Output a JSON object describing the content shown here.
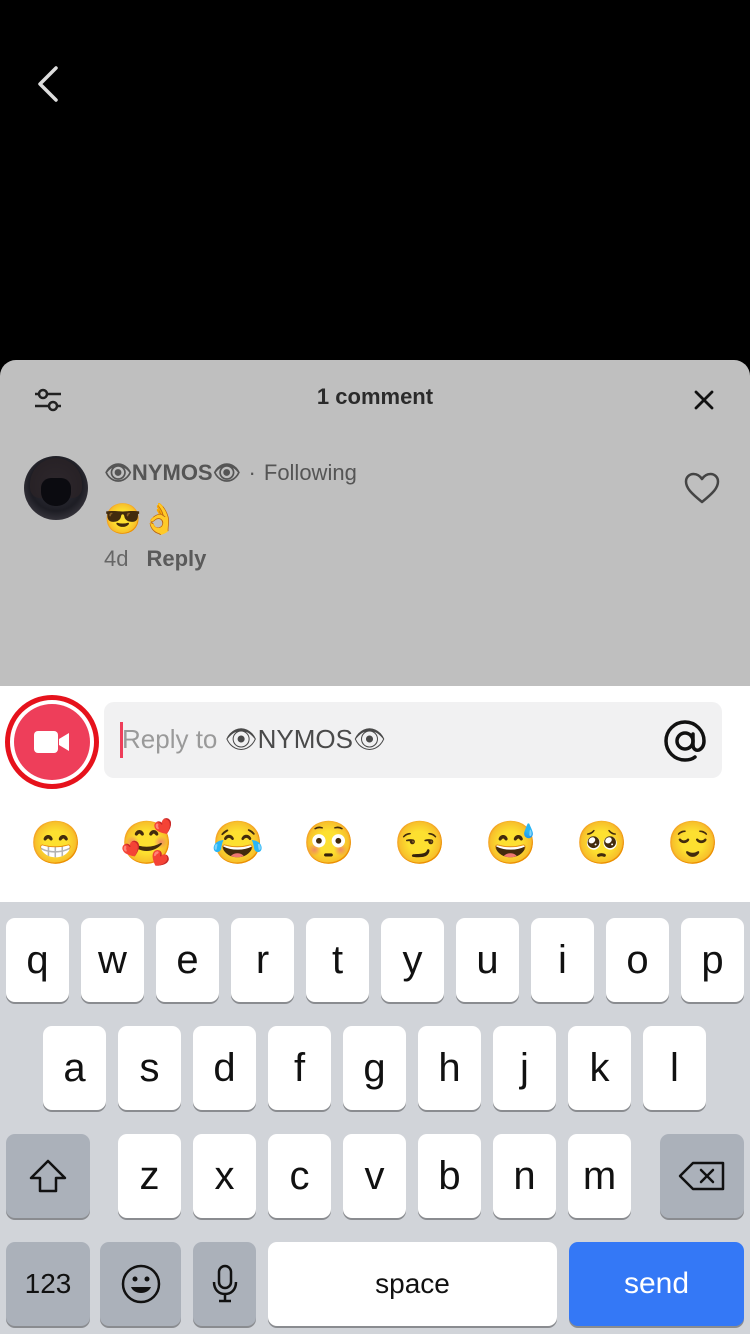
{
  "nav": {
    "back_icon": "chevron-left-icon"
  },
  "sheet": {
    "title": "1 comment",
    "filter_icon": "sliders-icon",
    "close_icon": "close-icon"
  },
  "comment": {
    "username": "👁NYMOS👁",
    "separator": "·",
    "following": "Following",
    "text": "😎👌",
    "time": "4d",
    "reply": "Reply",
    "like_icon": "heart-outline-icon"
  },
  "composer": {
    "placeholder_prefix": "Reply to ",
    "placeholder_name": "👁NYMOS👁",
    "video_icon": "video-camera-icon",
    "at_icon": "at-sign-icon",
    "accent": "#ee3e5a",
    "highlight_ring": "#e6121c"
  },
  "emoji_suggestions": [
    "😁",
    "🥰",
    "😂",
    "😳",
    "😏",
    "😅",
    "🥺",
    "😌"
  ],
  "keyboard": {
    "row1": [
      "q",
      "w",
      "e",
      "r",
      "t",
      "y",
      "u",
      "i",
      "o",
      "p"
    ],
    "row2": [
      "a",
      "s",
      "d",
      "f",
      "g",
      "h",
      "j",
      "k",
      "l"
    ],
    "row3": [
      "z",
      "x",
      "c",
      "v",
      "b",
      "n",
      "m"
    ],
    "shift_icon": "shift-icon",
    "delete_icon": "backspace-icon",
    "numbers": "123",
    "emoji_icon": "emoji-face-icon",
    "mic_icon": "microphone-icon",
    "space": "space",
    "send": "send",
    "send_color": "#3478f6"
  }
}
